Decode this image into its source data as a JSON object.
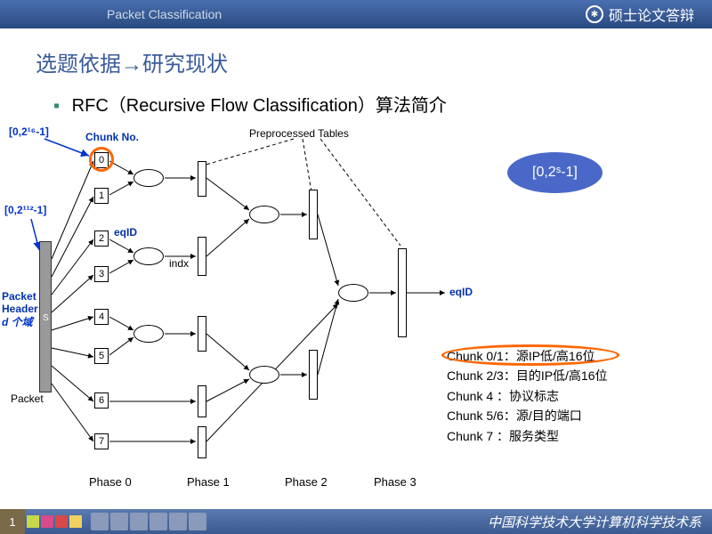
{
  "topbar": {
    "left": "Packet Classification",
    "right": "硕士论文答辩"
  },
  "title": "选题依据→研究现状",
  "subtitle": "RFC（Recursive Flow Classification）算法简介",
  "diagram": {
    "range_top": "[0,2¹⁶-1]",
    "range_left": "[0,2¹¹²-1]",
    "chunk_no_label": "Chunk No.",
    "eqid_label": "eqID",
    "indx_label": "indx",
    "preprocessed": "Preprocessed Tables",
    "packet_header": "Packet Header",
    "d_fields": "d 个域",
    "packet": "Packet",
    "eqid_out": "eqID",
    "chunks": [
      "0",
      "1",
      "2",
      "3",
      "4",
      "5",
      "6",
      "7"
    ],
    "phases": [
      "Phase 0",
      "Phase 1",
      "Phase 2",
      "Phase 3"
    ],
    "oval": "[0,2ˢ-1]"
  },
  "legend": [
    "Chunk 0/1：源IP低/高16位",
    "Chunk 2/3：目的IP低/高16位",
    "Chunk 4   ：协议标志",
    "Chunk 5/6：源/目的端口",
    "Chunk 7   ：服务类型"
  ],
  "footer": {
    "page": "1",
    "org": "中国科学技术大学计算机科学技术系"
  }
}
